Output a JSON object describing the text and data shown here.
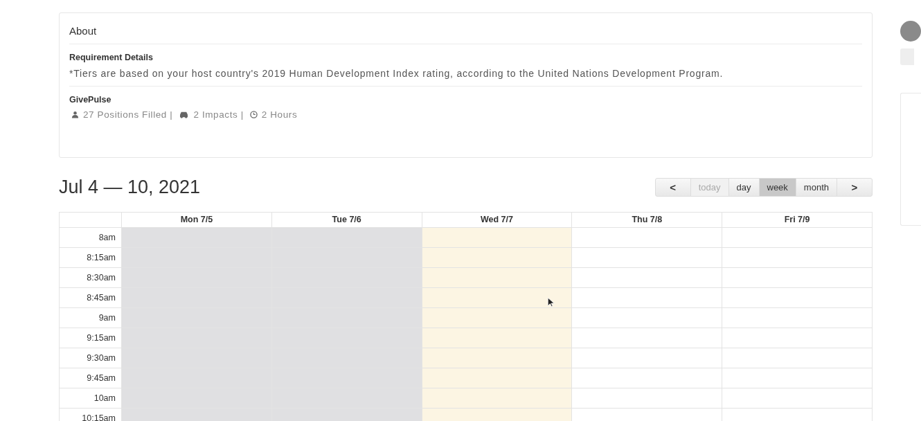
{
  "about": {
    "title": "About",
    "sections": [
      {
        "heading": "Requirement Details",
        "text": "*Tiers are based on your host country's 2019 Human Development Index rating, according to the United Nations Development Program."
      },
      {
        "heading": "GivePulse",
        "stats": [
          {
            "kind": "positions",
            "text": "27 Positions Filled |"
          },
          {
            "kind": "impacts",
            "text": "2 Impacts |"
          },
          {
            "kind": "hours",
            "text": "2 Hours"
          }
        ]
      }
    ]
  },
  "calendar": {
    "title": "Jul 4 — 10, 2021",
    "toolbar": [
      {
        "kind": "prev",
        "label": "<",
        "selected": false,
        "disabled": false
      },
      {
        "kind": "view",
        "label": "today",
        "selected": false,
        "disabled": true
      },
      {
        "kind": "view",
        "label": "day",
        "selected": false,
        "disabled": false
      },
      {
        "kind": "view",
        "label": "week",
        "selected": true,
        "disabled": false
      },
      {
        "kind": "view",
        "label": "month",
        "selected": false,
        "disabled": false
      },
      {
        "kind": "next",
        "label": ">",
        "selected": false,
        "disabled": false
      }
    ],
    "days": [
      {
        "label": "Mon 7/5",
        "past": true,
        "today": false
      },
      {
        "label": "Tue 7/6",
        "past": true,
        "today": false
      },
      {
        "label": "Wed 7/7",
        "past": false,
        "today": true
      },
      {
        "label": "Thu 7/8",
        "past": false,
        "today": false
      },
      {
        "label": "Fri 7/9",
        "past": false,
        "today": false
      }
    ],
    "times": [
      "8am",
      "8:15am",
      "8:30am",
      "8:45am",
      "9am",
      "9:15am",
      "9:30am",
      "9:45am",
      "10am",
      "10:15am"
    ]
  }
}
